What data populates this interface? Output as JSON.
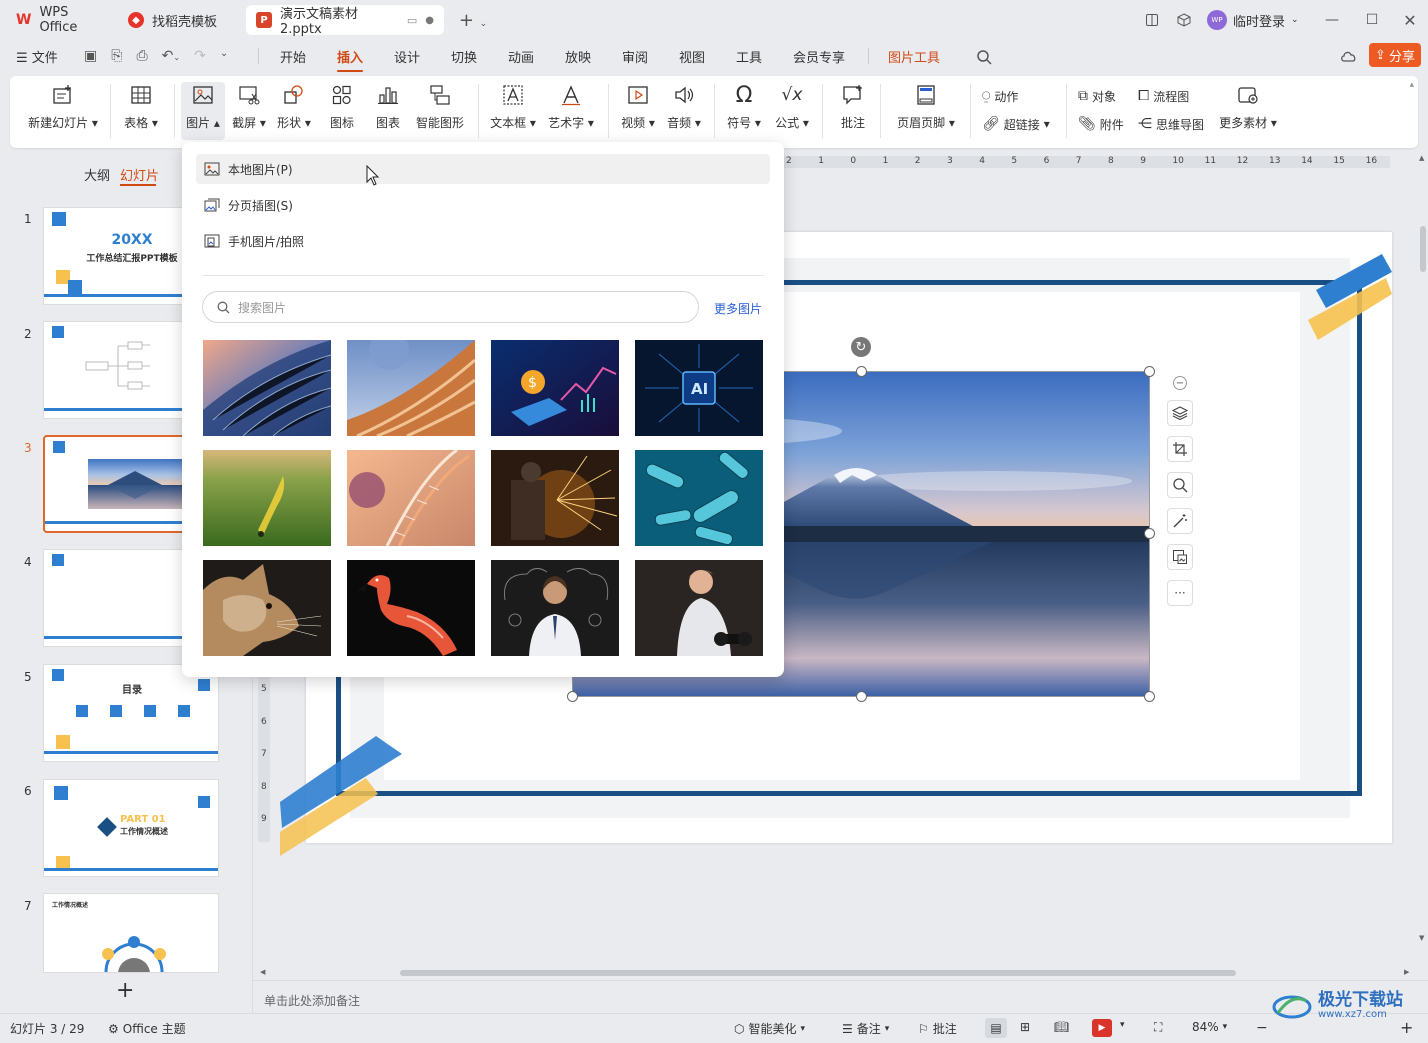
{
  "titlebar": {
    "tabs": [
      {
        "label": "WPS Office",
        "icon": "wps-logo-icon"
      },
      {
        "label": "找稻壳模板",
        "icon": "docer-icon"
      },
      {
        "label": "演示文稿素材2.pptx",
        "icon": "ppt-file-icon"
      }
    ],
    "user_label": "临时登录",
    "avatar_text": "WP"
  },
  "menubar": {
    "file_label": "文件",
    "items": [
      "开始",
      "插入",
      "设计",
      "切换",
      "动画",
      "放映",
      "审阅",
      "视图",
      "工具",
      "会员专享"
    ],
    "active_item": "插入",
    "picture_tools_label": "图片工具",
    "share_label": "分享"
  },
  "ribbon": {
    "new_slide": "新建幻灯片",
    "table": "表格",
    "picture": "图片",
    "screenshot": "截屏",
    "shape": "形状",
    "icon": "图标",
    "chart": "图表",
    "smartart": "智能图形",
    "textbox": "文本框",
    "wordart": "艺术字",
    "video": "视频",
    "audio": "音频",
    "symbol": "符号",
    "formula": "公式",
    "comment": "批注",
    "header_footer": "页眉页脚",
    "action": "动作",
    "hyperlink": "超链接",
    "object": "对象",
    "attachment": "附件",
    "flowchart": "流程图",
    "mindmap": "思维导图",
    "more_material": "更多素材"
  },
  "left_panel": {
    "tab_outline": "大纲",
    "tab_slides": "幻灯片",
    "slides": [
      {
        "num": "1",
        "title": "20XX",
        "subtitle": "工作总结汇报PPT模板"
      },
      {
        "num": "2"
      },
      {
        "num": "3"
      },
      {
        "num": "4"
      },
      {
        "num": "5",
        "title": "目录"
      },
      {
        "num": "6",
        "title": "PART 01",
        "subtitle": "工作情况概述"
      },
      {
        "num": "7",
        "title": "工作情况概述"
      }
    ],
    "selected_slide": 3,
    "add_slide": "+"
  },
  "dropdown": {
    "items": [
      "本地图片(P)",
      "分页插图(S)",
      "手机图片/拍照"
    ],
    "search_placeholder": "搜索图片",
    "more_pictures": "更多图片",
    "ai_badge": "AI",
    "images": [
      "building-image",
      "desert-image",
      "finance-phone-image",
      "ai-chip-image",
      "field-image",
      "dna-image",
      "sparks-image",
      "bacteria-image",
      "cat-image",
      "flamingo-image",
      "thinking-man-image",
      "fitness-woman-image"
    ]
  },
  "ruler": {
    "top_numbers": [
      "2",
      "1",
      "0",
      "1",
      "2",
      "3",
      "4",
      "5",
      "6",
      "7",
      "8",
      "9",
      "10",
      "11",
      "12",
      "13",
      "14",
      "15",
      "16"
    ],
    "left_numbers": [
      "5",
      "6",
      "7",
      "8",
      "9"
    ]
  },
  "notes_placeholder": "单击此处添加备注",
  "statusbar": {
    "slide_counter": "幻灯片 3 / 29",
    "theme": "Office 主题",
    "smart_beautify": "智能美化",
    "notes": "备注",
    "comments": "批注",
    "zoom": "84%"
  },
  "watermark": {
    "title": "极光下载站",
    "url": "www.xz7.com"
  },
  "colors": {
    "accent": "#d04a16",
    "share_bg": "#ee5a24",
    "slide_frame": "#1a4f84",
    "slide_blue": "#2f7fd0",
    "slide_yellow": "#f6c14f",
    "selection_border": "#e0672b",
    "link": "#2a5fd3"
  }
}
